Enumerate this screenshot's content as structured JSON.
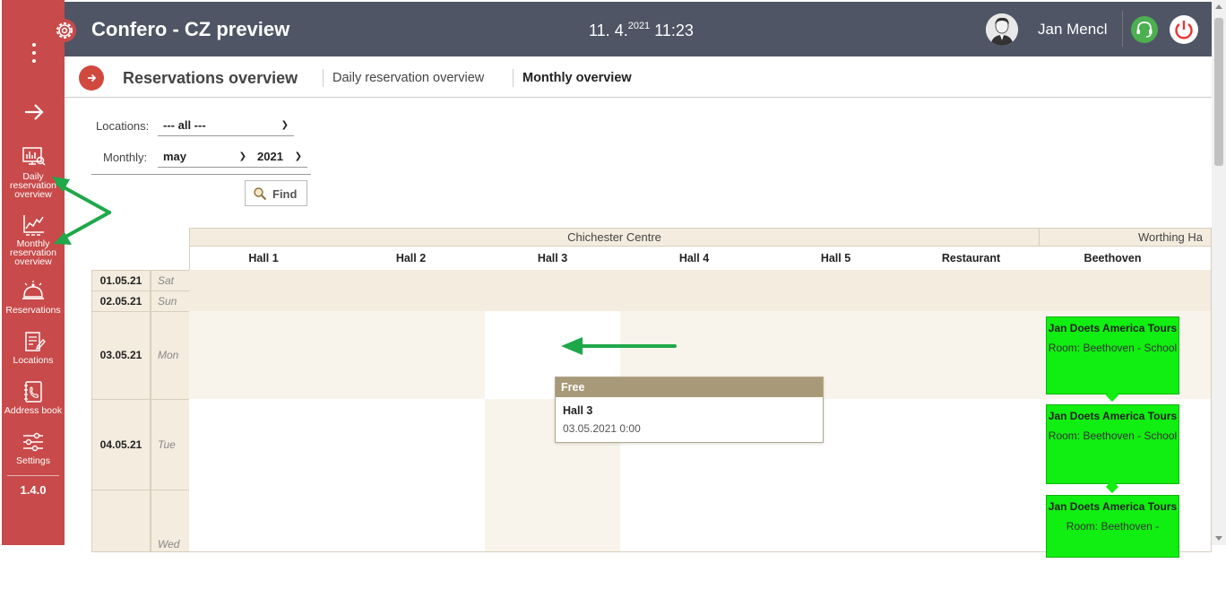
{
  "app": {
    "title": "Confero - CZ preview",
    "clock_day": "11. 4.",
    "clock_year": "2021",
    "clock_time": "11:23",
    "user_name": "Jan Mencl",
    "version": "1.4.0"
  },
  "sidebar": {
    "items": [
      {
        "label": "Daily reservation overview",
        "icon": "daily-overview-icon"
      },
      {
        "label": "Monthly reservation overview",
        "icon": "monthly-overview-icon"
      },
      {
        "label": "Reservations",
        "icon": "bell-icon"
      },
      {
        "label": "Locations",
        "icon": "locations-icon"
      },
      {
        "label": "Address book",
        "icon": "address-book-icon"
      },
      {
        "label": "Settings",
        "icon": "sliders-icon"
      }
    ]
  },
  "breadcrumb": {
    "title": "Reservations overview",
    "links": [
      "Daily reservation overview",
      "Monthly overview"
    ]
  },
  "filters": {
    "locations_label": "Locations:",
    "locations_value": "--- all ---",
    "monthly_label": "Monthly:",
    "month_value": "may",
    "year_value": "2021",
    "find_label": "Find"
  },
  "calendar": {
    "locations": [
      "Chichester Centre",
      "Worthing Ha"
    ],
    "columns": [
      "Hall 1",
      "Hall 2",
      "Hall 3",
      "Hall 4",
      "Hall 5",
      "Restaurant",
      "Beethoven"
    ],
    "rows": [
      {
        "date": "01.05.21",
        "day": "Sat"
      },
      {
        "date": "02.05.21",
        "day": "Sun"
      },
      {
        "date": "03.05.21",
        "day": "Mon"
      },
      {
        "date": "04.05.21",
        "day": "Tue"
      },
      {
        "date": "",
        "day": "Wed"
      }
    ],
    "bookings": [
      {
        "title": "Jan Doets America Tours",
        "room": "Room: Beethoven - School"
      },
      {
        "title": "Jan Doets America Tours",
        "room": "Room: Beethoven - School"
      },
      {
        "title": "Jan Doets America Tours",
        "room": "Room: Beethoven -"
      }
    ],
    "tooltip": {
      "status": "Free",
      "room": "Hall 3",
      "datetime": "03.05.2021 0:00"
    }
  },
  "colors": {
    "sidebar": "#c84a4a",
    "topbar": "#4f5564",
    "booking": "#11ee11",
    "weekend": "#f3ecdf",
    "annotation_arrow": "#1fa84a"
  }
}
